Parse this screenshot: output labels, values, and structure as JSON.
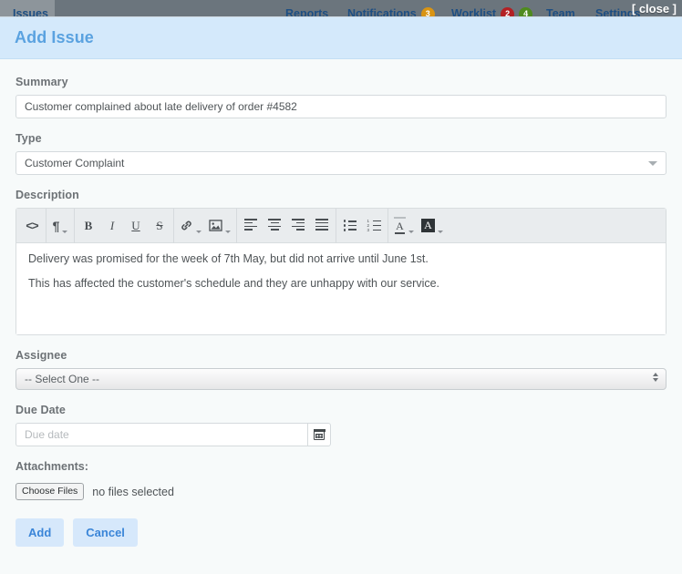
{
  "navbar": {
    "active_tab": "Issues",
    "links": [
      {
        "label": "Reports",
        "badges": []
      },
      {
        "label": "Notifications",
        "badges": [
          {
            "count": "3",
            "color": "#d99413"
          }
        ]
      },
      {
        "label": "Worklist",
        "badges": [
          {
            "count": "2",
            "color": "#b32024"
          },
          {
            "count": "4",
            "color": "#4f8b1e"
          }
        ]
      },
      {
        "label": "Team",
        "badges": []
      },
      {
        "label": "Settings",
        "badges": []
      }
    ],
    "close_label": "[ close ]"
  },
  "modal": {
    "title": "Add Issue",
    "summary": {
      "label": "Summary",
      "value": "Customer complained about late delivery of order #4582",
      "placeholder": ""
    },
    "type": {
      "label": "Type",
      "value": "Customer Complaint"
    },
    "description": {
      "label": "Description",
      "paragraphs": [
        "Delivery was promised for the week of 7th May, but did not arrive until June 1st.",
        "This has affected the customer's schedule and they are unhappy with our service."
      ],
      "toolbar": [
        {
          "name": "source-code-icon",
          "glyph": "<>"
        },
        {
          "name": "paragraph-format-icon",
          "glyph": "¶"
        },
        {
          "name": "bold-icon",
          "glyph": "B"
        },
        {
          "name": "italic-icon",
          "glyph": "I"
        },
        {
          "name": "underline-icon",
          "glyph": "U"
        },
        {
          "name": "strikethrough-icon",
          "glyph": "S"
        },
        {
          "name": "insert-link-icon",
          "glyph": "🔗"
        },
        {
          "name": "insert-image-icon",
          "glyph": "🏞"
        },
        {
          "name": "align-left-icon",
          "glyph": ""
        },
        {
          "name": "align-center-icon",
          "glyph": ""
        },
        {
          "name": "align-right-icon",
          "glyph": ""
        },
        {
          "name": "align-justify-icon",
          "glyph": ""
        },
        {
          "name": "bulleted-list-icon",
          "glyph": ""
        },
        {
          "name": "numbered-list-icon",
          "glyph": ""
        },
        {
          "name": "text-color-icon",
          "glyph": "A"
        },
        {
          "name": "highlight-color-icon",
          "glyph": "A"
        }
      ]
    },
    "assignee": {
      "label": "Assignee",
      "selected": "-- Select One --"
    },
    "due_date": {
      "label": "Due Date",
      "value": "",
      "placeholder": "Due date"
    },
    "attachments": {
      "label": "Attachments:",
      "choose_label": "Choose Files",
      "status": "no files selected"
    },
    "buttons": {
      "add": "Add",
      "cancel": "Cancel"
    },
    "colors": {
      "header_bg": "#d4e9fb",
      "title": "#5aa2e0",
      "button_bg": "#d6e8fb",
      "button_text": "#3a85d8"
    }
  }
}
